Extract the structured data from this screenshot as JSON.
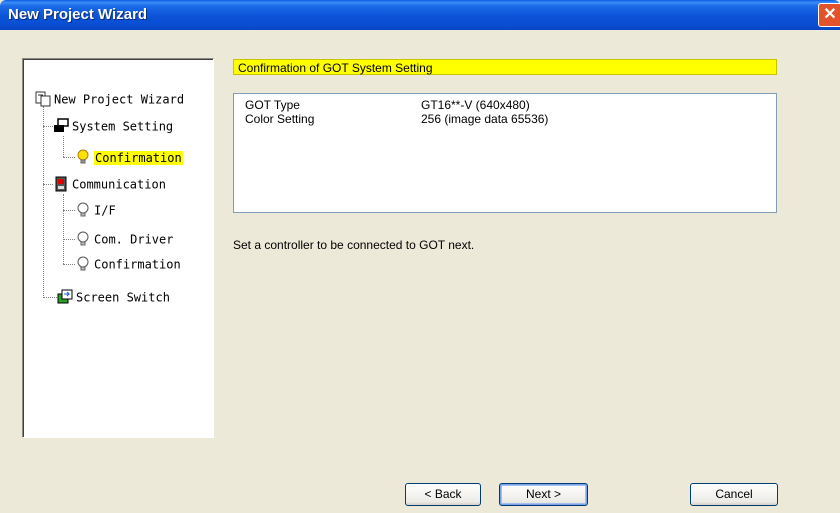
{
  "window": {
    "title": "New Project Wizard"
  },
  "tree": {
    "root": "New Project Wizard",
    "system_setting": "System Setting",
    "system_confirmation": "Confirmation",
    "communication": "Communication",
    "if": "I/F",
    "com_driver": "Com. Driver",
    "comm_confirmation": "Confirmation",
    "screen_switch": "Screen Switch"
  },
  "main": {
    "header": "Confirmation of GOT System Setting",
    "rows": [
      {
        "key": "GOT Type",
        "value": "GT16**-V (640x480)"
      },
      {
        "key": "Color Setting",
        "value": "256 (image data 65536)"
      }
    ],
    "message": "Set a controller to be connected to GOT next."
  },
  "buttons": {
    "back": "< Back",
    "next": "Next >",
    "cancel": "Cancel"
  },
  "colors": {
    "highlight": "#ffff00",
    "title_bar": "#0a52d8"
  }
}
